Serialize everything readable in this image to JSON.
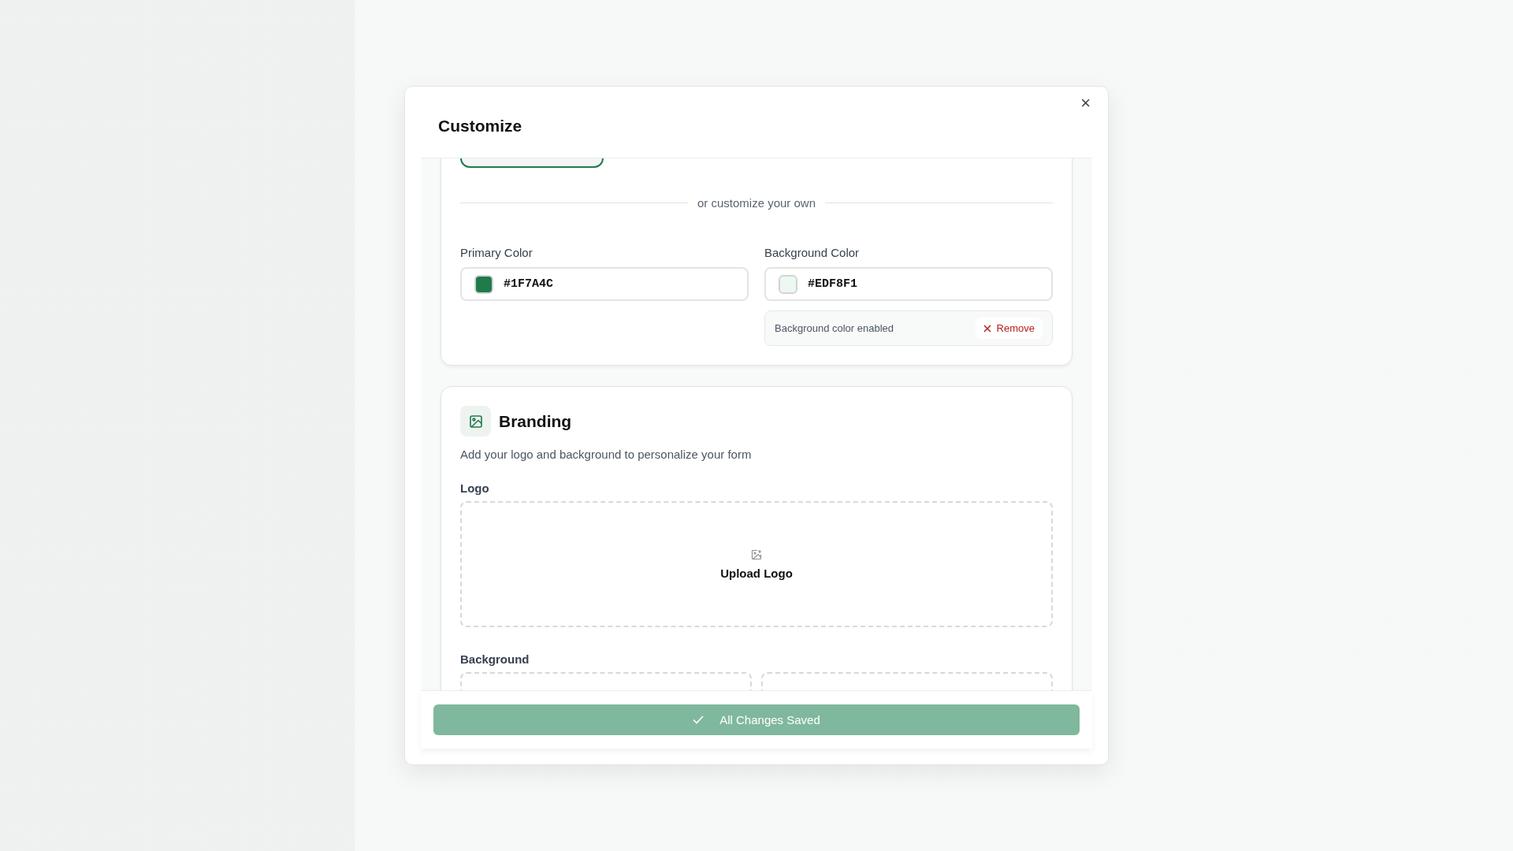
{
  "dialog": {
    "title": "Customize",
    "close": "×"
  },
  "theme_option": {
    "selected": true
  },
  "divider_text": "or customize your own",
  "colors": [
    {
      "label": "Primary Color",
      "value": "#1F7A4C"
    },
    {
      "label": "Background Color",
      "value": "#EDF8F1"
    }
  ],
  "background_status": {
    "text": "Background color enabled",
    "action": "Remove"
  },
  "branding": {
    "title": "Branding",
    "description": "Add your logo and background to personalize your form",
    "logo_label": "Logo",
    "upload_label": "Upload Logo",
    "background_label": "Background"
  },
  "save_button": {
    "label": "All Changes Saved",
    "disabled": true
  }
}
